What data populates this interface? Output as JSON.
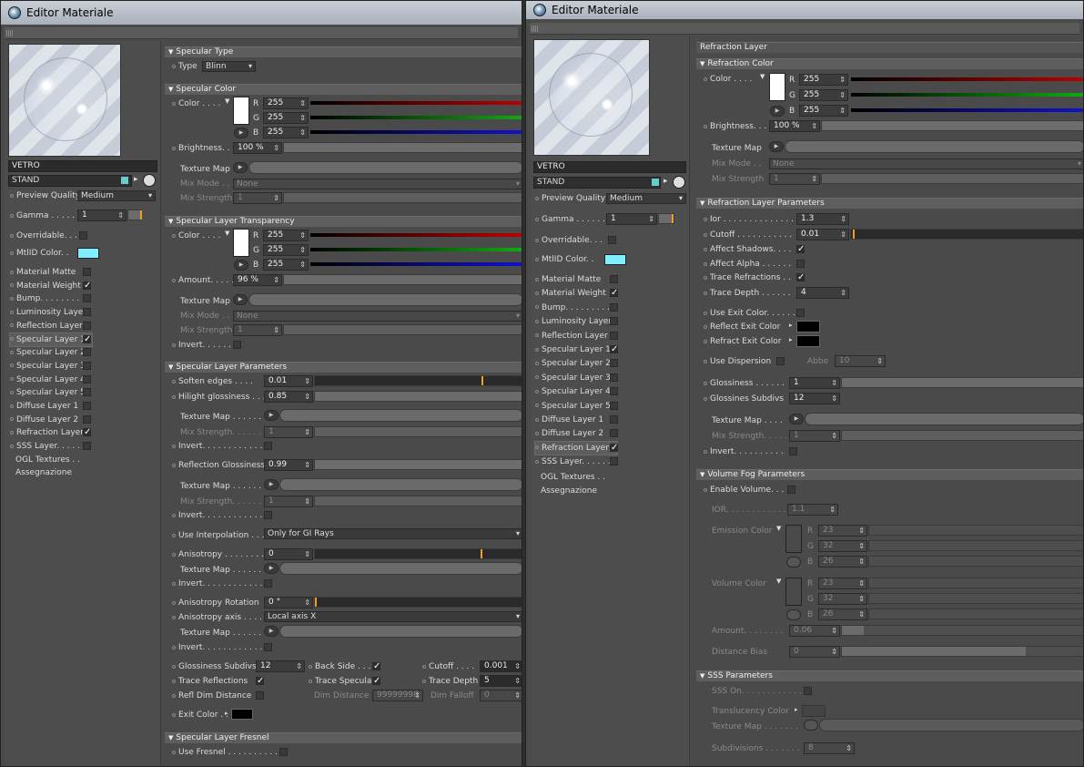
{
  "window_title": "Editor Materiale",
  "material_name": "VETRO",
  "material_name_b": "VETRO",
  "stand": "STAND",
  "preview_quality_label": "Preview Quality",
  "preview_quality": "Medium",
  "gamma_label": "Gamma . . . . . .",
  "gamma": "1",
  "overridable": "Overridable. . .",
  "mtlid": "MtlID Color. .",
  "layers": [
    "Material Matte",
    "Material Weight",
    "Bump. . . . . . . . .",
    "Luminosity Layer",
    "Reflection Layer",
    "Specular Layer 1",
    "Specular Layer 2",
    "Specular Layer 3",
    "Specular Layer 4",
    "Specular Layer 5",
    "Diffuse Layer 1",
    "Diffuse Layer 2",
    "Refraction Layer",
    "SSS Layer. . . . . ."
  ],
  "layers_b": [
    "Material Matte",
    "Material Weight",
    "Bump. . . . . . . . .",
    "Luminosity Layer",
    "Reflection Layer",
    "Specular Layer 1",
    "Specular Layer 2",
    "Specular Layer 3",
    "Specular Layer 4",
    "Specular Layer 5",
    "Diffuse Layer 1",
    "Diffuse Layer 2",
    "Refraction Layer",
    "SSS Layer. . . . . ."
  ],
  "ogl": "OGL Textures . .",
  "assegnazione": "Assegnazione",
  "colors": {
    "accent": "#f0a020",
    "mtlid": "#7ff0ff"
  },
  "A": {
    "spec_type_title": "Specular Type",
    "type_label": "Type",
    "type": "Blinn",
    "spec_color_title": "Specular Color",
    "color_label": "Color . . . .",
    "r": "255",
    "g": "255",
    "b": "255",
    "brightness_label": "Brightness. .",
    "brightness": "100 %",
    "texture_map": "Texture Map",
    "mix_mode": "Mix Mode . .",
    "mix_mode_val": "None",
    "mix_strength": "Mix Strength",
    "mix_strength_val": "1",
    "transp_title": "Specular Layer Transparency",
    "amount_label": "Amount. . . . .",
    "amount": "96 %",
    "invert": "Invert. . . . . .",
    "params_title": "Specular Layer Parameters",
    "soften": "Soften edges . . . .",
    "soften_val": "0.01",
    "hilight": "Hilight glossiness . . .",
    "hilight_val": "0.85",
    "tex_map2": "Texture Map . . . . . .",
    "mix_str2": "Mix Strength. . . . . .",
    "invert2": "Invert. . . . . . . . . . . . .",
    "refl_gloss": "Reflection Glossiness",
    "refl_gloss_val": "0.99",
    "use_interp": "Use Interpolation . . .",
    "use_interp_val": "Only for GI Rays",
    "aniso": "Anisotropy . . . . . . . .",
    "aniso_val": "0",
    "aniso_rot": "Anisotropy Rotation",
    "aniso_rot_val": "0 °",
    "aniso_axis": "Anisotropy axis . . . .",
    "aniso_axis_val": "Local axis X",
    "gloss_subdivs": "Glossiness Subdivs",
    "gloss_subdivs_val": "12",
    "back_side": "Back Side . . .",
    "cutoff": "Cutoff . . . .",
    "cutoff_val": "0.001",
    "trace_refl": "Trace Reflections",
    "trace_spec": "Trace Specular",
    "trace_depth": "Trace Depth",
    "trace_depth_val": "5",
    "refl_dim": "Refl Dim Distance",
    "dim_dist": "Dim Distance",
    "dim_dist_val": "99999998",
    "dim_falloff": "Dim Falloff",
    "dim_falloff_val": "0",
    "exit_color": "Exit Color . . . .",
    "fresnel_title": "Specular Layer Fresnel",
    "use_fresnel": "Use Fresnel . . . . . . . . . ."
  },
  "B": {
    "header": "Refraction Layer",
    "refr_color_title": "Refraction Color",
    "color_label": "Color . . . .",
    "r": "255",
    "g": "255",
    "b": "255",
    "brightness_label": "Brightness. . .",
    "brightness": "100 %",
    "texture_map": "Texture Map",
    "mix_mode": "Mix Mode . .",
    "mix_mode_val": "None",
    "mix_strength": "Mix Strength",
    "mix_strength_val": "1",
    "params_title": "Refraction Layer Parameters",
    "ior": "Ior . . . . . . . . . . . . . .",
    "ior_val": "1.3",
    "cutoff": "Cutoff . . . . . . . . . . .",
    "cutoff_val": "0.01",
    "affect_shadows": "Affect Shadows. . . .",
    "affect_alpha": "Affect Alpha . . . . . .",
    "trace_refr": "Trace Refractions . .",
    "trace_depth": "Trace Depth . . . . . .",
    "trace_depth_val": "4",
    "use_exit": "Use Exit Color. . . . . .",
    "reflect_exit": "Reflect Exit Color",
    "refract_exit": "Refract Exit Color",
    "use_disp": "Use Dispersion",
    "abbe": "Abbe",
    "abbe_val": "10",
    "gloss": "Glossiness . . . . . .",
    "gloss_val": "1",
    "gloss_subdivs": "Glossines Subdivs",
    "gloss_subdivs_val": "12",
    "tex_map": "Texture Map . . . .",
    "mix_str": "Mix Strength. . . . .",
    "mix_str_val": "1",
    "invert": "Invert. . . . . . . . . .",
    "fog_title": "Volume Fog Parameters",
    "enable_vol": "Enable Volume. . .",
    "ior2": "IOR. . . . . . . . . . . .",
    "ior2_val": "1.1",
    "emission": "Emission Color",
    "er": "23",
    "eg": "32",
    "eb": "26",
    "vol_color": "Volume Color",
    "vr": "23",
    "vg": "32",
    "vb": "26",
    "amount": "Amount. . . . . . . .",
    "amount_val": "0.06",
    "dist_bias": "Distance Bias",
    "dist_bias_val": "0",
    "sss_title": "SSS Parameters",
    "sss_on": "SSS On. . . . . . . . . . . .",
    "transl": "Translucency Color",
    "tex_map2": "Texture Map . . . . . . .",
    "subdivs": "Subdivisions . . . . . . .",
    "subdivs_val": "8"
  }
}
